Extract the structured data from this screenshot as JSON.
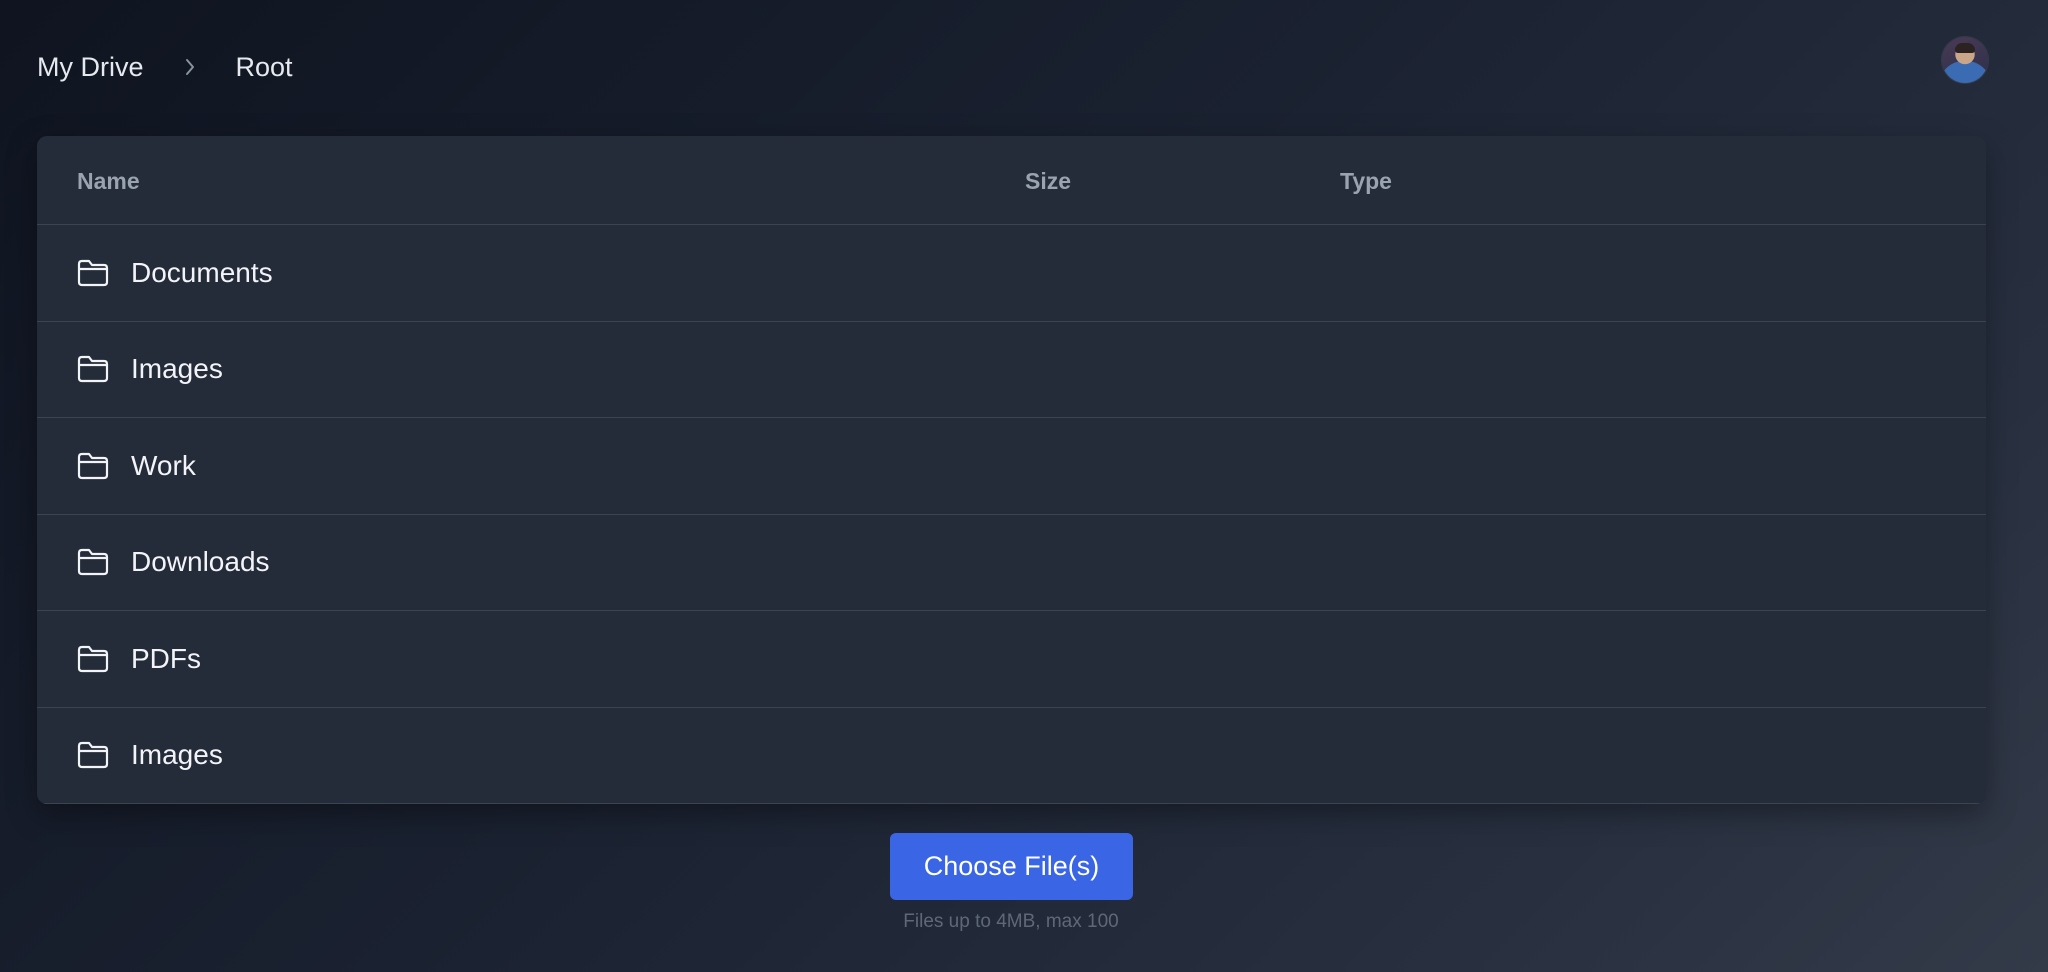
{
  "breadcrumb": {
    "items": [
      "My Drive",
      "Root"
    ]
  },
  "table": {
    "headers": {
      "name": "Name",
      "size": "Size",
      "type": "Type"
    },
    "rows": [
      {
        "name": "Documents",
        "icon": "folder-icon"
      },
      {
        "name": "Images",
        "icon": "folder-icon"
      },
      {
        "name": "Work",
        "icon": "folder-icon"
      },
      {
        "name": "Downloads",
        "icon": "folder-icon"
      },
      {
        "name": "PDFs",
        "icon": "folder-icon"
      },
      {
        "name": "Images",
        "icon": "folder-icon"
      }
    ]
  },
  "upload": {
    "button_label": "Choose File(s)",
    "hint": "Files up to 4MB, max 100"
  },
  "colors": {
    "accent": "#3a66e6",
    "panel": "#242b39",
    "divider": "#3c4452"
  }
}
